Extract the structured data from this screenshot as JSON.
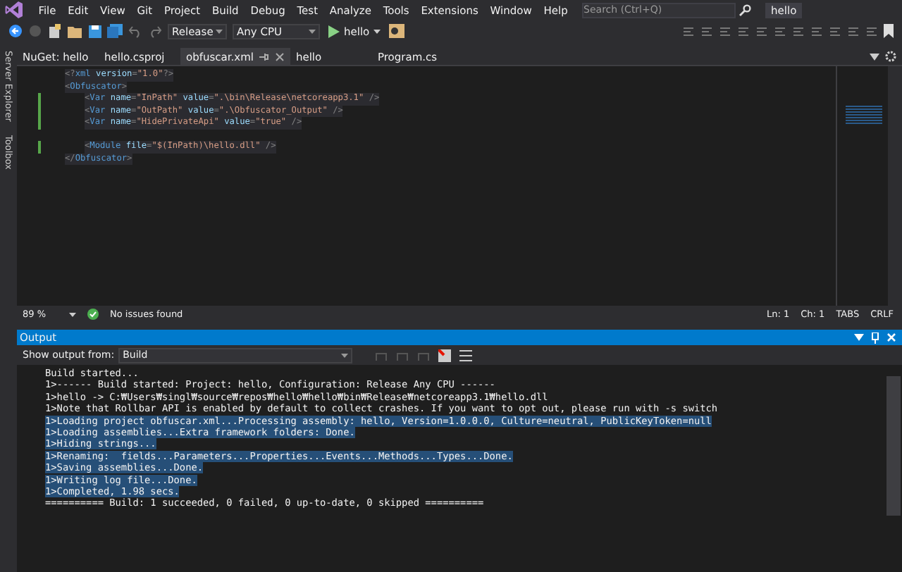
{
  "menu": [
    "File",
    "Edit",
    "View",
    "Git",
    "Project",
    "Build",
    "Debug",
    "Test",
    "Analyze",
    "Tools",
    "Extensions",
    "Window",
    "Help"
  ],
  "search": {
    "placeholder": "Search (Ctrl+Q)"
  },
  "solution_name": "hello",
  "toolbar": {
    "configuration": "Release",
    "platform": "Any CPU",
    "run_target": "hello"
  },
  "side_tabs": [
    "Server Explorer",
    "Toolbox"
  ],
  "tabs": [
    {
      "label": "NuGet: hello",
      "selected": false
    },
    {
      "label": "hello.csproj",
      "selected": false
    },
    {
      "label": "obfuscar.xml",
      "selected": true
    },
    {
      "label": "hello",
      "selected": false
    },
    {
      "label": "Program.cs",
      "selected": false
    }
  ],
  "code_lines": [
    {
      "kind": "code",
      "changed": false,
      "tokens": [
        {
          "kind": "punct",
          "text": "<?"
        },
        {
          "kind": "tag",
          "text": "xml"
        },
        {
          "kind": "attr",
          "text": " version"
        },
        {
          "kind": "punct",
          "text": "="
        },
        {
          "kind": "value",
          "text": "\"1.0\""
        },
        {
          "kind": "punct",
          "text": "?>"
        }
      ]
    },
    {
      "kind": "code",
      "changed": false,
      "tokens": [
        {
          "kind": "punct",
          "text": "<"
        },
        {
          "kind": "tag",
          "text": "Obfuscator"
        },
        {
          "kind": "punct",
          "text": ">"
        }
      ],
      "children": [
        {
          "kind": "code",
          "changed": true,
          "tokens": [
            {
              "kind": "punct",
              "text": "<"
            },
            {
              "kind": "tag",
              "text": "Var"
            },
            {
              "kind": "attr",
              "text": " name"
            },
            {
              "kind": "punct",
              "text": "="
            },
            {
              "kind": "value",
              "text": "\"InPath\""
            },
            {
              "kind": "attr",
              "text": " value"
            },
            {
              "kind": "punct",
              "text": "="
            },
            {
              "kind": "value",
              "text": "\".\\bin\\Release\\netcoreapp3.1\""
            },
            {
              "kind": "punct",
              "text": " />"
            }
          ]
        },
        {
          "kind": "code",
          "changed": true,
          "tokens": [
            {
              "kind": "punct",
              "text": "<"
            },
            {
              "kind": "tag",
              "text": "Var"
            },
            {
              "kind": "attr",
              "text": " name"
            },
            {
              "kind": "punct",
              "text": "="
            },
            {
              "kind": "value",
              "text": "\"OutPath\""
            },
            {
              "kind": "attr",
              "text": " value"
            },
            {
              "kind": "punct",
              "text": "="
            },
            {
              "kind": "value",
              "text": "\".\\Obfuscator_Output\""
            },
            {
              "kind": "punct",
              "text": " />"
            }
          ]
        },
        {
          "kind": "code",
          "changed": true,
          "tokens": [
            {
              "kind": "punct",
              "text": "<"
            },
            {
              "kind": "tag",
              "text": "Var"
            },
            {
              "kind": "attr",
              "text": " name"
            },
            {
              "kind": "punct",
              "text": "="
            },
            {
              "kind": "value",
              "text": "\"HidePrivateApi\""
            },
            {
              "kind": "attr",
              "text": " value"
            },
            {
              "kind": "punct",
              "text": "="
            },
            {
              "kind": "value",
              "text": "\"true\""
            },
            {
              "kind": "punct",
              "text": " />"
            }
          ]
        },
        {
          "kind": "blank",
          "changed": false
        },
        {
          "kind": "code",
          "changed": true,
          "tokens": [
            {
              "kind": "punct",
              "text": "<"
            },
            {
              "kind": "tag",
              "text": "Module"
            },
            {
              "kind": "attr",
              "text": " file"
            },
            {
              "kind": "punct",
              "text": "="
            },
            {
              "kind": "value",
              "text": "\"$(InPath)\\hello.dll\""
            },
            {
              "kind": "punct",
              "text": " />"
            }
          ]
        }
      ]
    },
    {
      "kind": "code",
      "changed": false,
      "tokens": [
        {
          "kind": "punct",
          "text": "</"
        },
        {
          "kind": "tag",
          "text": "Obfuscator"
        },
        {
          "kind": "punct",
          "text": ">"
        }
      ]
    }
  ],
  "status": {
    "zoom": "89 %",
    "issues": "No issues found",
    "line": "Ln: 1",
    "column": "Ch: 1",
    "indent": "TABS",
    "line_ending": "CRLF"
  },
  "output": {
    "title": "Output",
    "show_from_label": "Show output from:",
    "source": "Build",
    "lines": [
      {
        "text": "Build started...",
        "selected": false
      },
      {
        "text": "1>------ Build started: Project: hello, Configuration: Release Any CPU ------",
        "selected": false
      },
      {
        "text": "1>hello -> C:₩Users₩singl₩source₩repos₩hello₩hello₩bin₩Release₩netcoreapp3.1₩hello.dll",
        "selected": false
      },
      {
        "text": "1>Note that Rollbar API is enabled by default to collect crashes. If you want to opt out, please run with -s switch",
        "selected": false
      },
      {
        "text": "1>Loading project obfuscar.xml...Processing assembly: hello, Version=1.0.0.0, Culture=neutral, PublicKeyToken=null",
        "selected": true
      },
      {
        "text": "1>Loading assemblies...Extra framework folders: Done.",
        "selected": true
      },
      {
        "text": "1>Hiding strings...",
        "selected": true
      },
      {
        "text": "1>Renaming:  fields...Parameters...Properties...Events...Methods...Types...Done.",
        "selected": true
      },
      {
        "text": "1>Saving assemblies...Done.",
        "selected": true
      },
      {
        "text": "1>Writing log file...Done.",
        "selected": true
      },
      {
        "text": "1>Completed, 1.98 secs.",
        "selected": true
      },
      {
        "text": "========== Build: 1 succeeded, 0 failed, 0 up-to-date, 0 skipped ==========",
        "selected": false
      }
    ]
  }
}
